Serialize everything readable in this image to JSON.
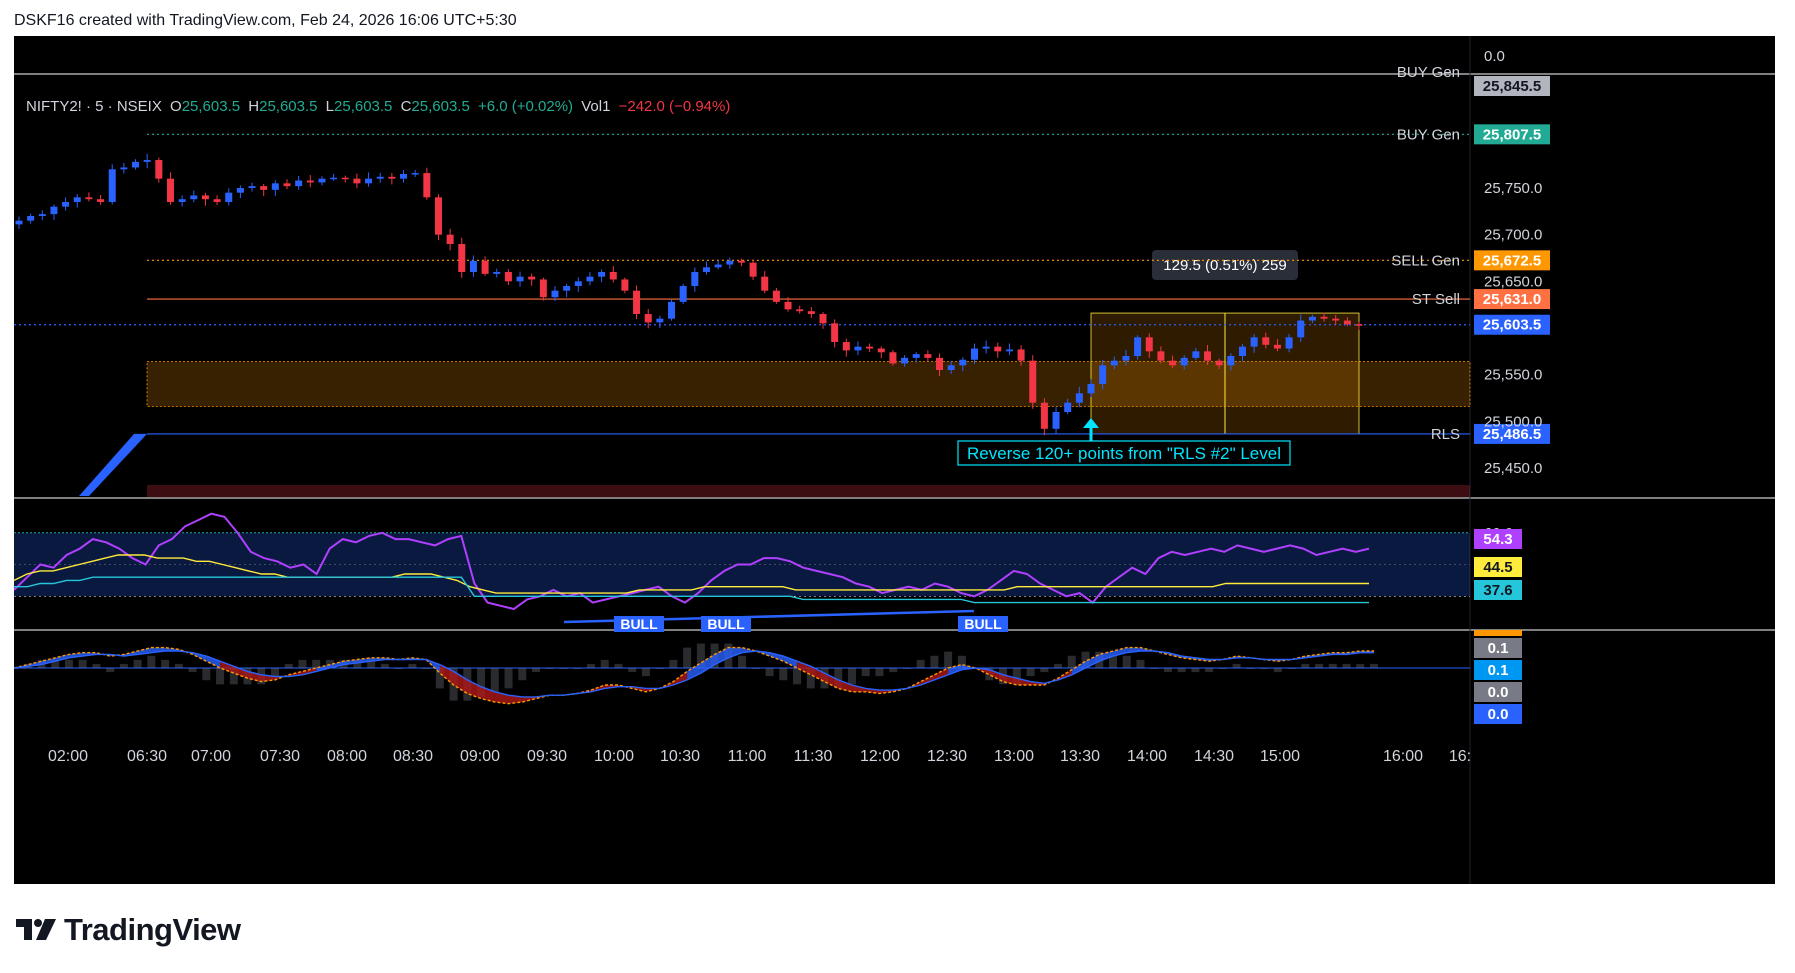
{
  "caption": "DSKF16 created with TradingView.com, Feb 24, 2026 16:06 UTC+5:30",
  "brand": {
    "name": "TradingView"
  },
  "legend": {
    "symbol": "NIFTY2! · 5 · NSEIX",
    "o_label": "O",
    "o": "25,603.5",
    "h_label": "H",
    "h": "25,603.5",
    "l_label": "L",
    "l": "25,603.5",
    "c_label": "C",
    "c": "25,603.5",
    "change": "+6.0 (+0.02%)",
    "vol_label": "Vol",
    "vol": "1",
    "vol_change": "−242.0 (−0.94%)"
  },
  "colors": {
    "background": "#000000",
    "up": "#2962ff",
    "down": "#f23645",
    "buy_gen": "#22ab94",
    "sell_gen": "#ff9800",
    "st_sell": "#ff7043",
    "rls": "#2962ff",
    "oscillator_main": "#b040ff",
    "oscillator_signal": "#ffeb3b",
    "oscillator_base": "#26c6da"
  },
  "chart_data": [
    {
      "type": "candlestick",
      "title": "",
      "x_ticks": [
        "02:00",
        "06:30",
        "07:00",
        "07:30",
        "08:00",
        "08:30",
        "09:00",
        "09:30",
        "10:00",
        "10:30",
        "11:00",
        "11:30",
        "12:00",
        "12:30",
        "13:00",
        "13:30",
        "14:00",
        "14:30",
        "15:00",
        "16:00",
        "16:"
      ],
      "y_ticks": [
        "0.0",
        "25,750.0",
        "25,700.0",
        "25,650.0",
        "25,550.0",
        "25,500.0",
        "25,450.0"
      ],
      "ylim": [
        25420,
        25870
      ],
      "levels": [
        {
          "name": "BUY Gen",
          "value": 25807.5,
          "label": "25,807.5",
          "style": "dotted",
          "color": "#22ab94"
        },
        {
          "name": "SELL Gen",
          "value": 25672.5,
          "label": "25,672.5",
          "style": "dotted",
          "color": "#ff9800"
        },
        {
          "name": "ST Sell",
          "value": 25631.0,
          "label": "25,631.0",
          "style": "solid",
          "color": "#ff7043"
        },
        {
          "name": "",
          "value": 25603.5,
          "label": "25,603.5",
          "style": "dotted",
          "color": "#2962ff"
        },
        {
          "name": "RLS",
          "value": 25486.5,
          "label": "25,486.5",
          "style": "solid",
          "color": "#2962ff"
        }
      ],
      "hidden_level": {
        "name": "BUY Gen",
        "label": "25,845.5"
      },
      "zone": {
        "from": 25516,
        "to": 25564
      },
      "measure": {
        "label": "129.5 (0.51%) 259",
        "from": 25486.5,
        "to": 25616
      },
      "annotation": "Reverse 120+ points from \"RLS #2\" Level",
      "closes": [
        25715,
        25720,
        25722,
        25730,
        25735,
        25740,
        25738,
        25735,
        25770,
        25772,
        25778,
        25780,
        25760,
        25735,
        25738,
        25742,
        25738,
        25735,
        25745,
        25750,
        25752,
        25748,
        25755,
        25752,
        25758,
        25756,
        25760,
        25761,
        25760,
        25755,
        25760,
        25762,
        25760,
        25765,
        25766,
        25740,
        25700,
        25690,
        25660,
        25672,
        25658,
        25660,
        25650,
        25655,
        25652,
        25633,
        25640,
        25645,
        25650,
        25655,
        25660,
        25652,
        25640,
        25615,
        25606,
        25610,
        25628,
        25645,
        25660,
        25665,
        25668,
        25672,
        25670,
        25655,
        25640,
        25628,
        25620,
        25618,
        25615,
        25605,
        25585,
        25576,
        25580,
        25578,
        25574,
        25562,
        25568,
        25572,
        25568,
        25555,
        25560,
        25566,
        25578,
        25580,
        25575,
        25577,
        25565,
        25520,
        25492,
        25510,
        25520,
        25530,
        25540,
        25560,
        25565,
        25570,
        25590,
        25575,
        25565,
        25560,
        25568,
        25575,
        25565,
        25560,
        25570,
        25580,
        25590,
        25582,
        25578,
        25590,
        25608,
        25612,
        25610,
        25608,
        25604,
        25603.5
      ]
    },
    {
      "type": "line",
      "title": "",
      "y_ticks": [
        "60.0"
      ],
      "current_values": [
        "54.3",
        "44.5",
        "37.6"
      ],
      "signals": [
        "BULL",
        "BULL",
        "BULL"
      ],
      "series": [
        {
          "color": "#b040ff",
          "values": [
            42,
            46,
            50,
            49,
            53,
            55,
            58,
            57,
            55,
            52,
            50,
            56,
            58,
            62,
            64,
            66,
            65,
            60,
            54,
            52,
            51,
            49,
            50,
            47,
            55,
            58,
            57,
            59,
            60,
            58,
            58,
            57,
            56,
            58,
            59,
            44,
            38,
            37,
            36,
            39,
            40,
            42,
            40,
            41,
            38,
            39,
            40,
            41,
            42,
            43,
            40,
            38,
            41,
            45,
            48,
            50,
            50,
            52,
            52,
            51,
            49,
            48,
            47,
            46,
            44,
            43,
            41,
            42,
            43,
            42,
            44,
            43,
            41,
            40,
            42,
            45,
            48,
            47,
            44,
            42,
            40,
            41,
            38,
            43,
            46,
            49,
            47,
            52,
            54,
            53,
            54,
            55,
            54,
            56,
            55,
            54,
            55,
            56,
            55,
            53,
            54,
            55,
            54,
            55
          ]
        },
        {
          "color": "#ffeb3b",
          "values": [
            45,
            47,
            48,
            48,
            49,
            50,
            51,
            52,
            53,
            53,
            53,
            52,
            52,
            52,
            51,
            51,
            50,
            49,
            48,
            47,
            47,
            46,
            46,
            46,
            46,
            46,
            46,
            46,
            46,
            46,
            47,
            47,
            47,
            46,
            45,
            43,
            42,
            41,
            41,
            41,
            41,
            41,
            41,
            41,
            41,
            41,
            41,
            41,
            42,
            42,
            42,
            42,
            42,
            43,
            43,
            43,
            43,
            43,
            43,
            43,
            42,
            42,
            42,
            42,
            42,
            42,
            42,
            42,
            42,
            42,
            42,
            42,
            42,
            42,
            42,
            42,
            42,
            43,
            43,
            43,
            43,
            43,
            43,
            43,
            43,
            43,
            43,
            43,
            43,
            43,
            43,
            43,
            43,
            44,
            44,
            44,
            44,
            44,
            44,
            44,
            44,
            44,
            44,
            44,
            44
          ]
        },
        {
          "color": "#26c6da",
          "values": [
            43,
            43,
            44,
            44,
            45,
            45,
            46,
            46,
            46,
            46,
            46,
            46,
            46,
            46,
            46,
            46,
            46,
            46,
            46,
            46,
            46,
            46,
            46,
            46,
            46,
            46,
            46,
            46,
            46,
            46,
            46,
            46,
            46,
            46,
            46,
            40,
            40,
            40,
            40,
            40,
            40,
            40,
            40,
            40,
            40,
            40,
            40,
            40,
            40,
            40,
            40,
            40,
            40,
            40,
            40,
            40,
            40,
            40,
            40,
            40,
            39,
            39,
            39,
            39,
            39,
            39,
            39,
            39,
            39,
            39,
            39,
            39,
            39,
            38,
            38,
            38,
            38,
            38,
            38,
            38,
            38,
            38,
            38,
            38,
            38,
            38,
            38,
            38,
            38,
            38,
            38,
            38,
            38,
            38,
            38,
            38,
            38,
            38,
            38,
            38,
            38,
            38,
            38,
            38
          ]
        }
      ]
    },
    {
      "type": "area",
      "title": "",
      "current_values": [
        "0.1",
        "0.1",
        "0.0",
        "0.0"
      ],
      "series": [
        {
          "color": "#ff9800",
          "values": [
            0.0,
            0.02,
            0.04,
            0.06,
            0.08,
            0.09,
            0.09,
            0.07,
            0.08,
            0.1,
            0.12,
            0.12,
            0.11,
            0.08,
            0.04,
            0.0,
            -0.03,
            -0.06,
            -0.08,
            -0.07,
            -0.04,
            -0.02,
            0.0,
            0.02,
            0.04,
            0.05,
            0.06,
            0.06,
            0.05,
            0.06,
            0.05,
            -0.03,
            -0.1,
            -0.15,
            -0.18,
            -0.2,
            -0.21,
            -0.2,
            -0.18,
            -0.16,
            -0.16,
            -0.15,
            -0.13,
            -0.1,
            -0.1,
            -0.12,
            -0.14,
            -0.12,
            -0.08,
            -0.02,
            0.03,
            0.08,
            0.12,
            0.12,
            0.1,
            0.07,
            0.04,
            0.0,
            -0.04,
            -0.08,
            -0.12,
            -0.14,
            -0.14,
            -0.15,
            -0.14,
            -0.12,
            -0.08,
            -0.04,
            0.0,
            0.02,
            0.0,
            -0.04,
            -0.08,
            -0.1,
            -0.1,
            -0.1,
            -0.06,
            -0.01,
            0.04,
            0.08,
            0.1,
            0.12,
            0.12,
            0.1,
            0.08,
            0.06,
            0.05,
            0.04,
            0.05,
            0.07,
            0.06,
            0.05,
            0.04,
            0.05,
            0.07,
            0.08,
            0.09,
            0.09,
            0.1,
            0.1
          ]
        },
        {
          "color": "#2962ff",
          "values": [
            0.0,
            0.01,
            0.02,
            0.04,
            0.06,
            0.07,
            0.08,
            0.08,
            0.07,
            0.08,
            0.09,
            0.1,
            0.1,
            0.09,
            0.07,
            0.04,
            0.01,
            -0.02,
            -0.04,
            -0.05,
            -0.05,
            -0.04,
            -0.02,
            0.0,
            0.02,
            0.03,
            0.04,
            0.05,
            0.05,
            0.05,
            0.05,
            0.02,
            -0.02,
            -0.07,
            -0.11,
            -0.14,
            -0.16,
            -0.17,
            -0.17,
            -0.16,
            -0.16,
            -0.15,
            -0.14,
            -0.12,
            -0.11,
            -0.11,
            -0.12,
            -0.12,
            -0.1,
            -0.07,
            -0.03,
            0.02,
            0.06,
            0.09,
            0.1,
            0.09,
            0.07,
            0.04,
            0.01,
            -0.03,
            -0.07,
            -0.1,
            -0.12,
            -0.13,
            -0.13,
            -0.12,
            -0.1,
            -0.07,
            -0.04,
            -0.01,
            0.0,
            -0.01,
            -0.04,
            -0.06,
            -0.08,
            -0.09,
            -0.07,
            -0.04,
            0.0,
            0.04,
            0.07,
            0.09,
            0.1,
            0.1,
            0.09,
            0.07,
            0.06,
            0.05,
            0.05,
            0.06,
            0.06,
            0.05,
            0.05,
            0.05,
            0.06,
            0.07,
            0.08,
            0.08,
            0.09,
            0.09
          ]
        }
      ]
    }
  ]
}
